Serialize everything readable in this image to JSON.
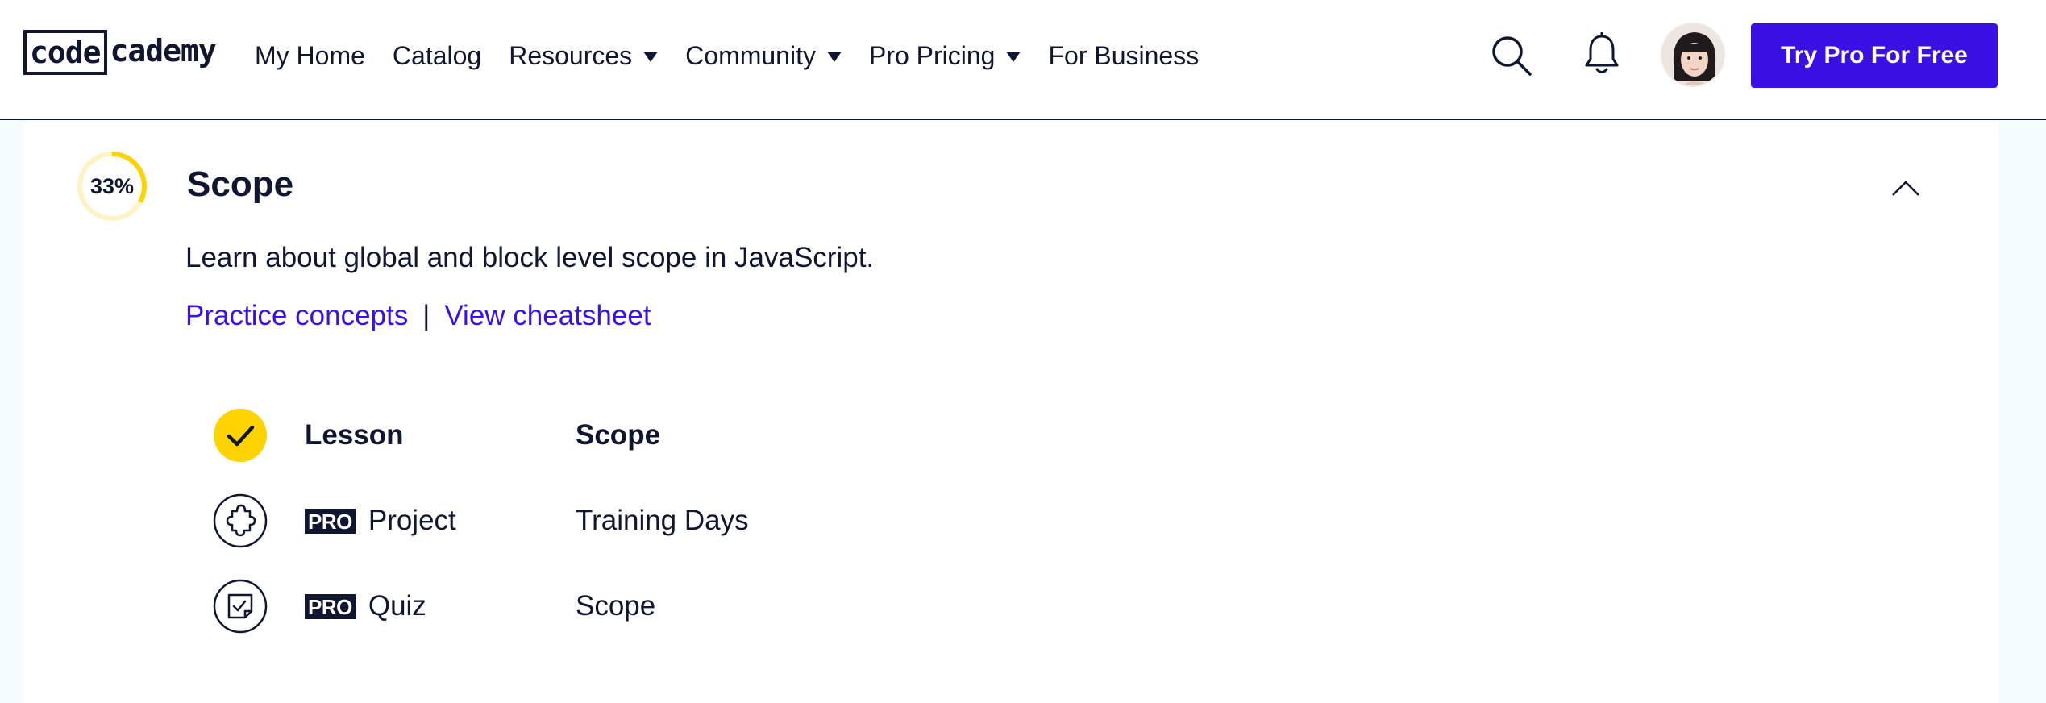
{
  "header": {
    "logo_left": "code",
    "logo_right": "cademy",
    "nav": [
      {
        "label": "My Home",
        "dropdown": false
      },
      {
        "label": "Catalog",
        "dropdown": false
      },
      {
        "label": "Resources",
        "dropdown": true
      },
      {
        "label": "Community",
        "dropdown": true
      },
      {
        "label": "Pro Pricing",
        "dropdown": true
      },
      {
        "label": "For Business",
        "dropdown": false
      }
    ],
    "cta_label": "Try Pro For Free"
  },
  "module": {
    "progress_label": "33%",
    "progress_fraction": 0.33,
    "title": "Scope",
    "description": "Learn about global and block level scope in JavaScript.",
    "practice_link": "Practice concepts",
    "separator": "|",
    "cheatsheet_link": "View cheatsheet",
    "items": [
      {
        "icon": "check-icon",
        "pro": "",
        "type": "Lesson",
        "name": "Scope",
        "completed": true
      },
      {
        "icon": "puzzle-icon",
        "pro": "PRO",
        "type": "Project",
        "name": "Training Days",
        "completed": false
      },
      {
        "icon": "quiz-icon",
        "pro": "PRO",
        "type": "Quiz",
        "name": "Scope",
        "completed": false
      }
    ]
  },
  "colors": {
    "brand": "#3a10e5",
    "navy": "#10162f",
    "progress_yellow": "#ffd300",
    "progress_track": "#fff3c4",
    "page_bg": "#f5fcff"
  }
}
